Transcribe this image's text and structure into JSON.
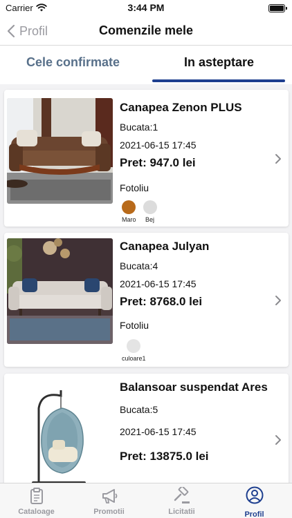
{
  "status_bar": {
    "carrier": "Carrier",
    "time": "3:44 PM"
  },
  "nav": {
    "back_label": "Profil",
    "title": "Comenzile mele"
  },
  "tabs": [
    {
      "label": "Cele confirmate",
      "active": false
    },
    {
      "label": "In asteptare",
      "active": true
    }
  ],
  "orders": [
    {
      "title": "Canapea Zenon PLUS",
      "quantity": "Bucata:1",
      "date": "2021-06-15 17:45",
      "price": "Pret: 947.0 lei",
      "category": "Fotoliu",
      "colors": [
        {
          "name": "Maro",
          "hex": "#b86a1a"
        },
        {
          "name": "Bej",
          "hex": "#dcdcdc"
        }
      ]
    },
    {
      "title": "Canapea Julyan",
      "quantity": "Bucata:4",
      "date": "2021-06-15 17:45",
      "price": "Pret: 8768.0 lei",
      "category": "Fotoliu",
      "colors": [
        {
          "name": "culoare1",
          "hex": "#e4e4e4"
        }
      ]
    },
    {
      "title": "Balansoar suspendat Ares",
      "quantity": "Bucata:5",
      "date": "2021-06-15 17:45",
      "price": "Pret: 13875.0 lei",
      "category": "",
      "colors": []
    }
  ],
  "tabbar": [
    {
      "label": "Cataloage",
      "icon": "clipboard-icon"
    },
    {
      "label": "Promotii",
      "icon": "megaphone-icon"
    },
    {
      "label": "Licitatii",
      "icon": "gavel-icon"
    },
    {
      "label": "Profil",
      "icon": "user-circle-icon",
      "active": true
    }
  ],
  "colors": {
    "accent": "#1e3f8f",
    "inactive_tab": "#58708a",
    "muted": "#9a9aa0"
  }
}
